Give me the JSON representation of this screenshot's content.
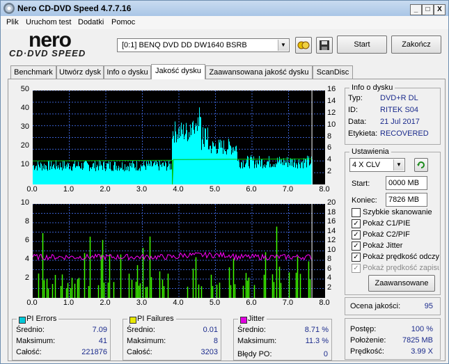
{
  "window": {
    "title": "Nero CD-DVD Speed 4.7.7.16",
    "buttons": {
      "minimize": "_",
      "maximize": "□",
      "close": "X"
    }
  },
  "menu": [
    "Plik",
    "Uruchom test",
    "Dodatki",
    "Pomoc"
  ],
  "logo": {
    "top": "nero",
    "bottom": "CD·DVD SPEED"
  },
  "toolbar": {
    "drive": "[0:1]   BENQ DVD DD DW1640 BSRB",
    "start_label": "Start",
    "exit_label": "Zakończ"
  },
  "tabs": [
    "Benchmark",
    "Utwórz dysk",
    "Info o dysku",
    "Jakość dysku",
    "Zaawansowana jakość dysku",
    "ScanDisc"
  ],
  "active_tab": "Jakość dysku",
  "disc_info": {
    "title": "Info o dysku",
    "rows": [
      {
        "label": "Typ:",
        "value": "DVD+R DL"
      },
      {
        "label": "ID:",
        "value": "RITEK S04"
      },
      {
        "label": "Data:",
        "value": "21 Jul 2017"
      },
      {
        "label": "Etykieta:",
        "value": "RECOVERED"
      }
    ]
  },
  "settings": {
    "title": "Ustawienia",
    "speed": "4 X CLV",
    "start_label": "Start:",
    "start_value": "0000 MB",
    "end_label": "Koniec:",
    "end_value": "7826 MB",
    "checkboxes": [
      {
        "label": "Szybkie skanowanie",
        "checked": false,
        "enabled": true
      },
      {
        "label": "Pokaż C1/PIE",
        "checked": true,
        "enabled": true
      },
      {
        "label": "Pokaż C2/PIF",
        "checked": true,
        "enabled": true
      },
      {
        "label": "Pokaż Jitter",
        "checked": true,
        "enabled": true
      },
      {
        "label": "Pokaż prędkość odczy",
        "checked": true,
        "enabled": true
      },
      {
        "label": "Pokaż prędkość zapisu",
        "checked": true,
        "enabled": false
      }
    ],
    "advanced_label": "Zaawansowane"
  },
  "quality": {
    "label": "Ocena jakości:",
    "value": "95"
  },
  "progress": {
    "rows": [
      {
        "label": "Postęp:",
        "value": "100 %"
      },
      {
        "label": "Położenie:",
        "value": "7825 MB"
      },
      {
        "label": "Prędkość:",
        "value": "3.99 X"
      }
    ]
  },
  "pi_errors": {
    "title": "PI Errors",
    "color": "#00c8d8",
    "rows": [
      {
        "label": "Średnio:",
        "value": "7.09"
      },
      {
        "label": "Maksimum:",
        "value": "41"
      },
      {
        "label": "Całość:",
        "value": "221876"
      }
    ]
  },
  "pi_failures": {
    "title": "PI Failures",
    "color": "#e8e800",
    "rows": [
      {
        "label": "Średnio:",
        "value": "0.01"
      },
      {
        "label": "Maksimum:",
        "value": "8"
      },
      {
        "label": "Całość:",
        "value": "3203"
      }
    ]
  },
  "jitter": {
    "title": "Jitter",
    "color": "#e000e0",
    "rows": [
      {
        "label": "Średnio:",
        "value": "8.71 %"
      },
      {
        "label": "Maksimum:",
        "value": "11.3 %"
      }
    ],
    "po_label": "Błędy PO:",
    "po_value": "0"
  },
  "chart_data": [
    {
      "type": "bar",
      "name": "PI Errors",
      "x_ticks": [
        "0.0",
        "1.0",
        "2.0",
        "3.0",
        "4.0",
        "5.0",
        "6.0",
        "7.0",
        "8.0"
      ],
      "y_left_ticks": [
        "50",
        "40",
        "30",
        "20",
        "10"
      ],
      "y_right_ticks": [
        "16",
        "14",
        "12",
        "10",
        "8",
        "6",
        "4",
        "2"
      ],
      "xlim": [
        0,
        8
      ],
      "ylim_left": [
        0,
        50
      ],
      "ylim_right": [
        0,
        16
      ],
      "colors": {
        "bars": "#00ffff",
        "speed": "#00c000",
        "grid": "#3a5fcd"
      },
      "segments": [
        {
          "from": 0.0,
          "to": 3.8,
          "base": 10,
          "noise": 6
        },
        {
          "from": 3.8,
          "to": 4.6,
          "base": 28,
          "noise": 12
        },
        {
          "from": 4.6,
          "to": 5.6,
          "base": 20,
          "noise": 9
        },
        {
          "from": 5.6,
          "to": 7.7,
          "base": 12,
          "noise": 7
        }
      ],
      "data_end": 7.64,
      "speed_line": 4.0
    },
    {
      "type": "bar",
      "name": "PI Failures / Jitter",
      "x_ticks": [
        "0.0",
        "1.0",
        "2.0",
        "3.0",
        "4.0",
        "5.0",
        "6.0",
        "7.0",
        "8.0"
      ],
      "y_left_ticks": [
        "10",
        "8",
        "6",
        "4",
        "2"
      ],
      "y_right_ticks": [
        "20",
        "18",
        "16",
        "14",
        "12",
        "10",
        "8",
        "6",
        "4",
        "2"
      ],
      "xlim": [
        0,
        8
      ],
      "ylim_left": [
        0,
        10
      ],
      "ylim_right": [
        0,
        20
      ],
      "colors": {
        "bars": "#40ff00",
        "jitter": "#ff00ff",
        "grid": "#3a5fcd"
      },
      "max_failures": 8,
      "jitter_avg": 8.71,
      "jitter_max": 11.3,
      "data_end": 7.64
    }
  ]
}
